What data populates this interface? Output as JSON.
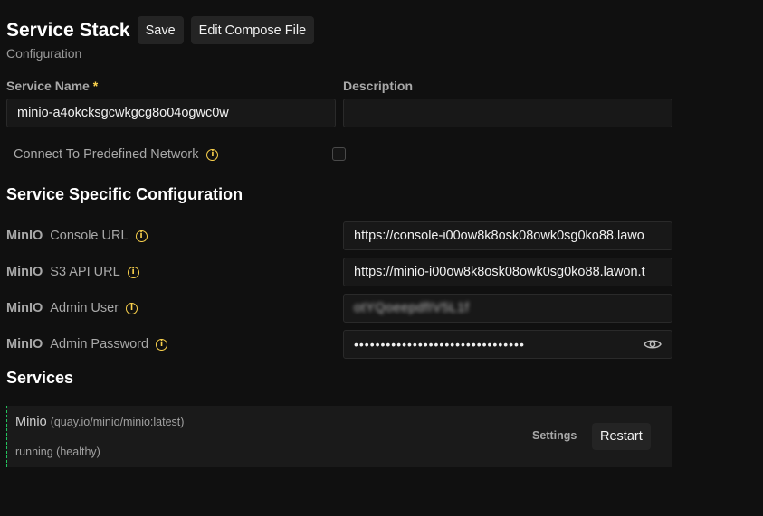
{
  "header": {
    "title": "Service Stack",
    "save_label": "Save",
    "edit_compose_label": "Edit Compose File",
    "subtitle": "Configuration"
  },
  "service_name": {
    "label": "Service Name",
    "required_mark": "*",
    "value": "minio-a4okcksgcwkgcg8o04ogwc0w"
  },
  "description": {
    "label": "Description",
    "value": ""
  },
  "predefined_network": {
    "label": "Connect To Predefined Network",
    "checked": false
  },
  "service_specific": {
    "title": "Service Specific Configuration",
    "rows": [
      {
        "prefix": "MinIO",
        "name": "Console URL",
        "value": "https://console-i00ow8k8osk08owk0sg0ko88.lawo"
      },
      {
        "prefix": "MinIO",
        "name": "S3 API URL",
        "value": "https://minio-i00ow8k8osk08owk0sg0ko88.lawon.t"
      },
      {
        "prefix": "MinIO",
        "name": "Admin User",
        "value": "otYQoeepdfIV5L1f"
      },
      {
        "prefix": "MinIO",
        "name": "Admin Password",
        "value": "••••••••••••••••••••••••••••••••"
      }
    ]
  },
  "services": {
    "title": "Services",
    "items": [
      {
        "name": "Minio",
        "image": "(quay.io/minio/minio:latest)",
        "status": "running (healthy)",
        "settings_label": "Settings",
        "restart_label": "Restart"
      }
    ]
  },
  "colors": {
    "background": "#101010",
    "accent_yellow": "#fcd34d",
    "status_border": "#22c55e"
  },
  "icons": {
    "info": "info-icon",
    "show_password": "eye-icon"
  }
}
